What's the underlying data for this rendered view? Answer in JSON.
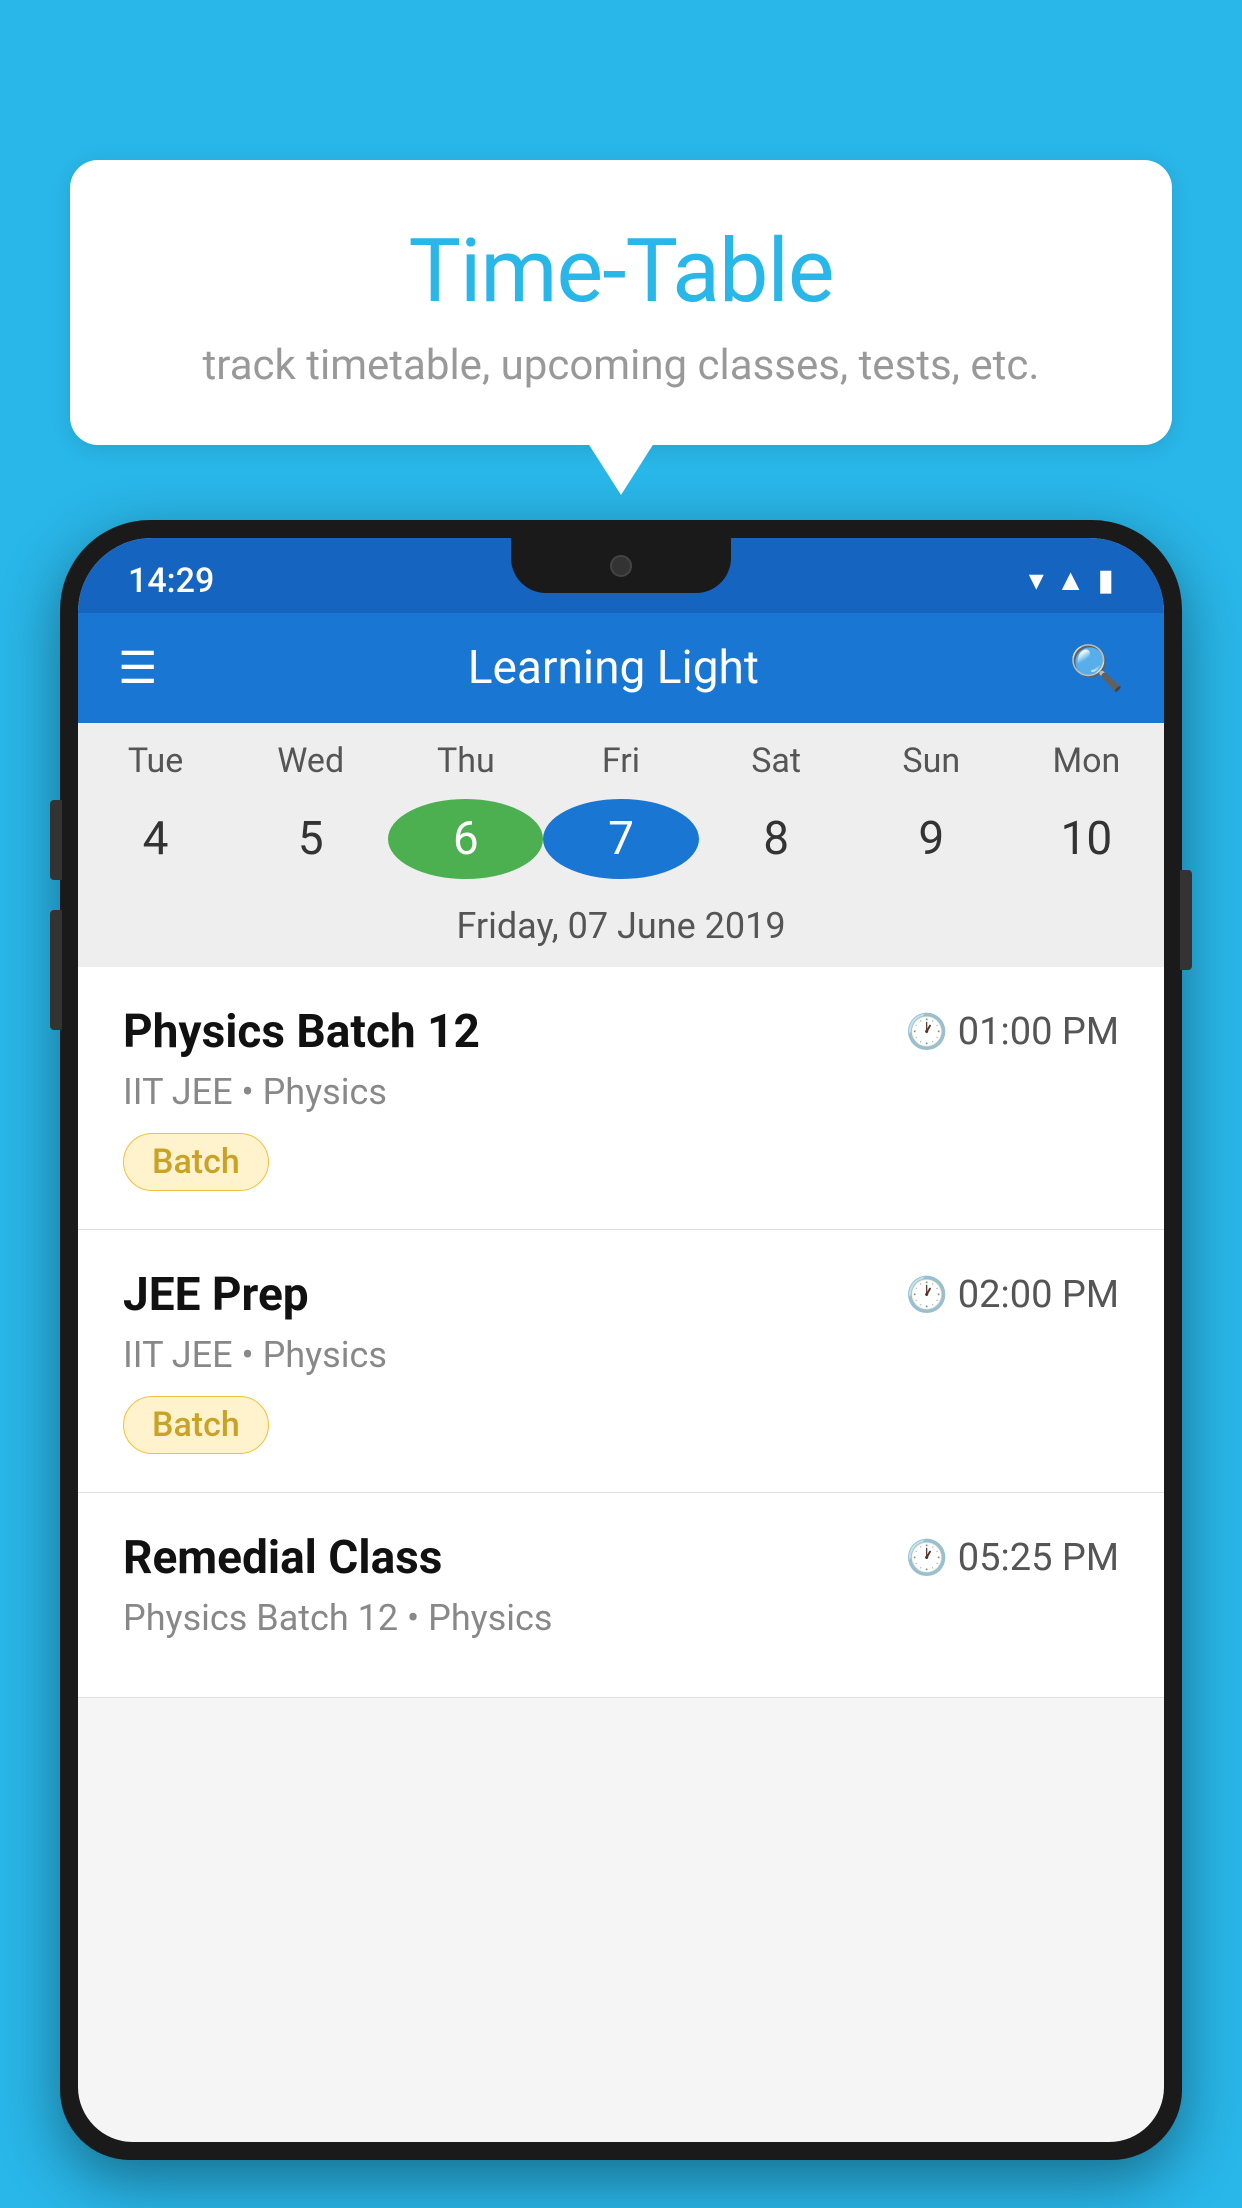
{
  "page": {
    "background_color": "#29B6E8"
  },
  "bubble": {
    "title": "Time-Table",
    "subtitle": "track timetable, upcoming classes, tests, etc."
  },
  "phone": {
    "status_bar": {
      "time": "14:29"
    },
    "app_bar": {
      "title": "Learning Light"
    },
    "calendar": {
      "days": [
        "Tue",
        "Wed",
        "Thu",
        "Fri",
        "Sat",
        "Sun",
        "Mon"
      ],
      "dates": [
        "4",
        "5",
        "6",
        "7",
        "8",
        "9",
        "10"
      ],
      "today_index": 2,
      "selected_index": 3,
      "selected_label": "Friday, 07 June 2019"
    },
    "classes": [
      {
        "name": "Physics Batch 12",
        "time": "01:00 PM",
        "meta": "IIT JEE • Physics",
        "tag": "Batch"
      },
      {
        "name": "JEE Prep",
        "time": "02:00 PM",
        "meta": "IIT JEE • Physics",
        "tag": "Batch"
      },
      {
        "name": "Remedial Class",
        "time": "05:25 PM",
        "meta": "Physics Batch 12 • Physics",
        "tag": ""
      }
    ]
  }
}
